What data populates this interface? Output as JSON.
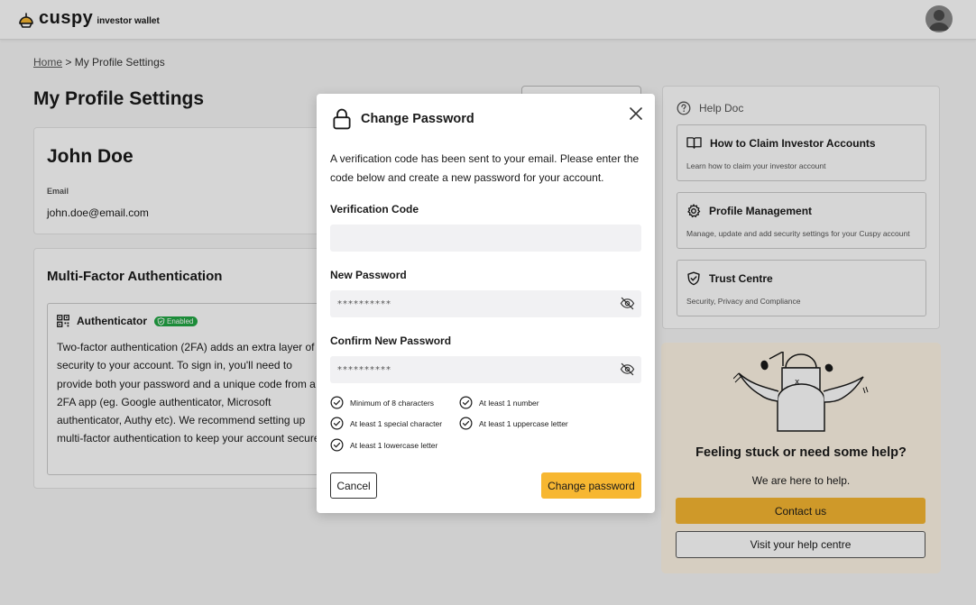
{
  "header": {
    "logo_word": "cuspy",
    "logo_sub": "investor wallet"
  },
  "breadcrumb": {
    "home": "Home",
    "separator": ">",
    "current": "My Profile Settings"
  },
  "page": {
    "title": "My Profile Settings"
  },
  "profile": {
    "name": "John Doe",
    "email_label": "Email",
    "email": "john.doe@email.com"
  },
  "mfa": {
    "title": "Multi-Factor Authentication",
    "authenticator_label": "Authenticator",
    "status_badge": "Enabled",
    "description": "Two-factor authentication (2FA) adds an extra layer of security to your account. To sign in, you'll need to provide both your password and a unique code from a 2FA app (eg. Google authenticator, Microsoft authenticator, Authy etc). We recommend setting up multi-factor authentication to keep your account secure"
  },
  "help": {
    "title": "Help Doc",
    "items": [
      {
        "title": "How to Claim Investor Accounts",
        "subtitle": "Learn how to claim your investor account",
        "icon": "book-icon"
      },
      {
        "title": "Profile Management",
        "subtitle": "Manage, update and add security settings for your Cuspy account",
        "icon": "gear-icon"
      },
      {
        "title": "Trust Centre",
        "subtitle": "Security, Privacy and Compliance",
        "icon": "shield-check-icon"
      }
    ],
    "cta_title": "Feeling stuck or need some help?",
    "cta_subtitle": "We are here to help.",
    "contact_label": "Contact us",
    "visit_label": "Visit your help centre"
  },
  "modal": {
    "title": "Change Password",
    "description": "A verification code has been sent to your email. Please enter the code below and create a new password for your account.",
    "verification_label": "Verification Code",
    "verification_value": "",
    "new_password_label": "New Password",
    "new_password_value": "**********",
    "confirm_password_label": "Confirm New Password",
    "confirm_password_value": "**********",
    "rules": [
      "Minimum of 8 characters",
      "At least 1 number",
      "At least 1 special character",
      "At least 1 uppercase letter",
      "At least 1 lowercase letter"
    ],
    "cancel_label": "Cancel",
    "submit_label": "Change password"
  },
  "colors": {
    "accent": "#f7b731",
    "success": "#22a745",
    "overlay": "rgba(0,0,0,0.16)"
  }
}
